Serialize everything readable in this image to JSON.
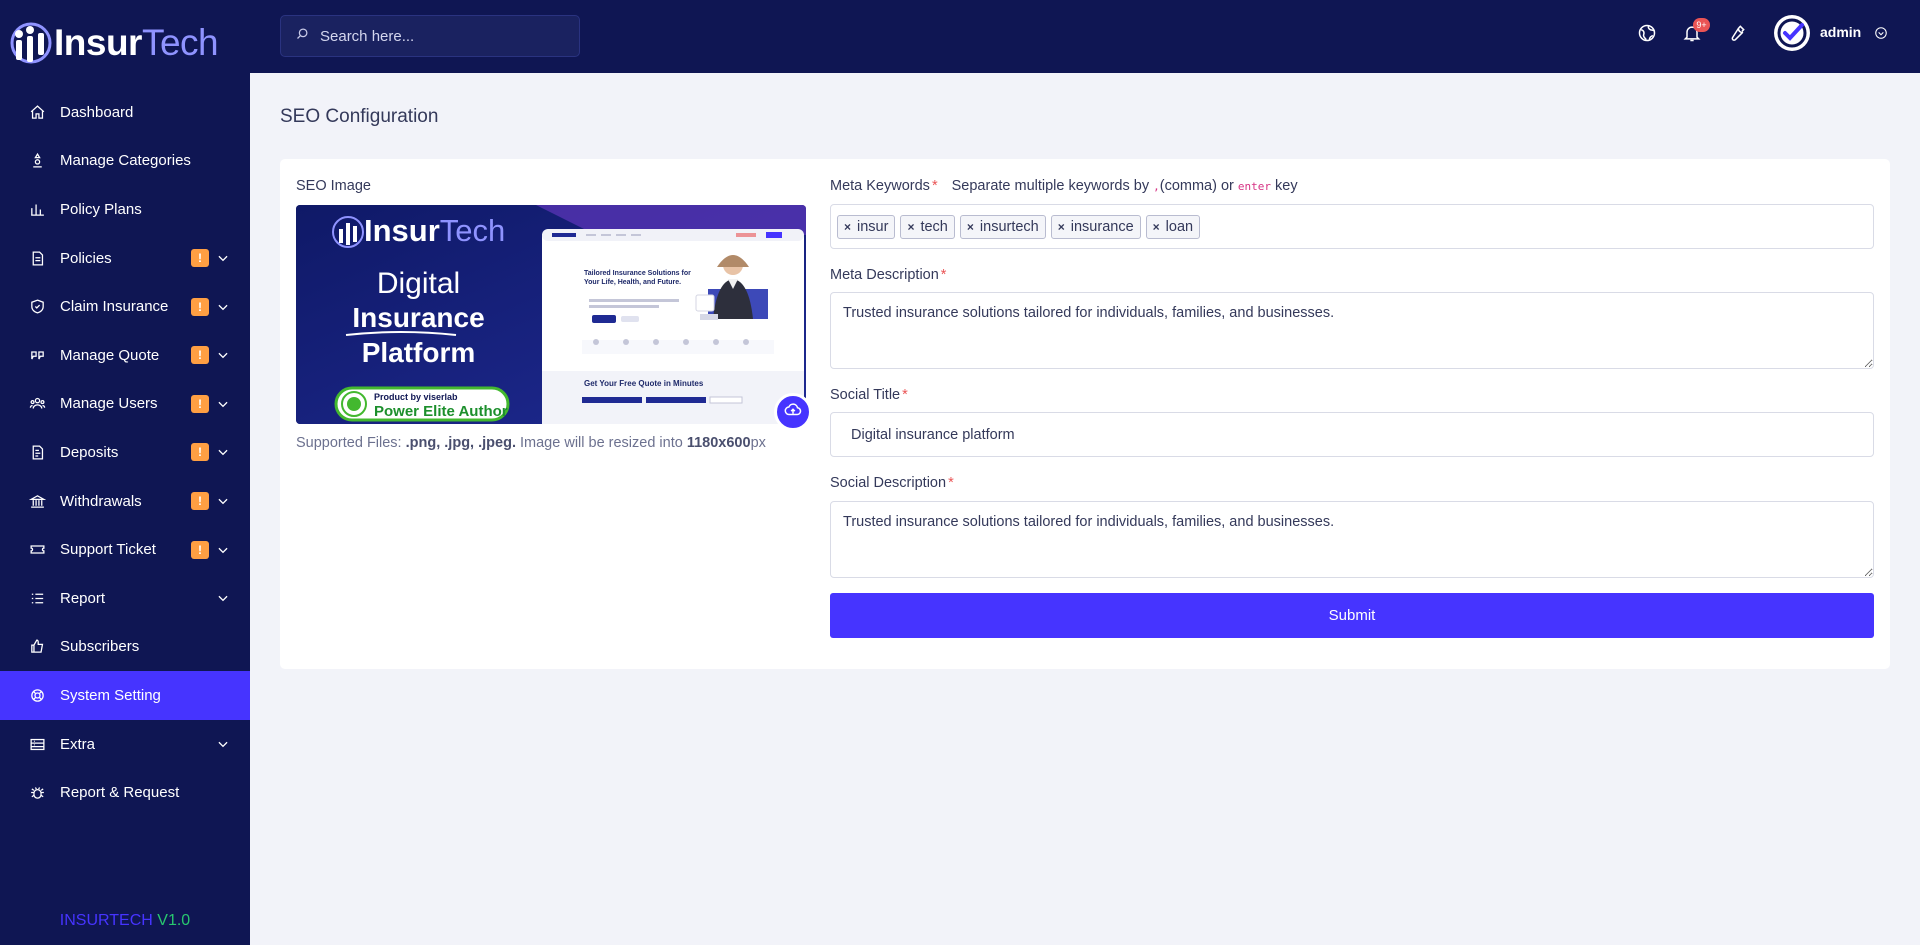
{
  "brand": {
    "name_part1": "Insur",
    "name_part2": "Tech"
  },
  "version": {
    "name": "INSURTECH",
    "number": "V1.0"
  },
  "search": {
    "placeholder": "Search here..."
  },
  "notifications": {
    "count": "9+"
  },
  "user": {
    "name": "admin"
  },
  "sidebar": {
    "items": [
      {
        "label": "Dashboard",
        "icon": "home-icon"
      },
      {
        "label": "Manage Categories",
        "icon": "category-icon"
      },
      {
        "label": "Policy Plans",
        "icon": "chart-icon"
      },
      {
        "label": "Policies",
        "icon": "document-icon",
        "badge": "!"
      },
      {
        "label": "Claim Insurance",
        "icon": "shield-icon",
        "badge": "!"
      },
      {
        "label": "Manage Quote",
        "icon": "quote-icon",
        "badge": "!"
      },
      {
        "label": "Manage Users",
        "icon": "users-icon",
        "badge": "!"
      },
      {
        "label": "Deposits",
        "icon": "deposit-icon",
        "badge": "!"
      },
      {
        "label": "Withdrawals",
        "icon": "bank-icon",
        "badge": "!"
      },
      {
        "label": "Support Ticket",
        "icon": "ticket-icon",
        "badge": "!"
      },
      {
        "label": "Report",
        "icon": "list-icon"
      },
      {
        "label": "Subscribers",
        "icon": "thumbs-up-icon"
      },
      {
        "label": "System Setting",
        "icon": "life-ring-icon",
        "active": true
      },
      {
        "label": "Extra",
        "icon": "server-icon"
      },
      {
        "label": "Report & Request",
        "icon": "bug-icon"
      }
    ]
  },
  "page": {
    "title": "SEO Configuration"
  },
  "form": {
    "seo_image_label": "SEO Image",
    "supported_prefix": "Supported Files: ",
    "supported_types": ".png, .jpg, .jpeg.",
    "supported_mid": " Image will be resized into ",
    "supported_size": "1180x600",
    "supported_unit": "px",
    "meta_keywords_label": "Meta Keywords",
    "keywords_hint_1": "Separate multiple keywords by ",
    "keywords_hint_comma": ",",
    "keywords_hint_2": "(comma) or ",
    "keywords_hint_enter": "enter",
    "keywords_hint_3": " key",
    "keywords": [
      "insur",
      "tech",
      "insurtech",
      "insurance",
      "loan"
    ],
    "meta_description_label": "Meta Description",
    "meta_description": "Trusted insurance solutions tailored for individuals, families, and businesses.",
    "social_title_label": "Social Title",
    "social_title": "Digital insurance platform",
    "social_description_label": "Social Description",
    "social_description": "Trusted insurance solutions tailored for individuals, families, and businesses.",
    "submit_label": "Submit"
  },
  "banner": {
    "logo_part1": "Insur",
    "logo_part2": "Tech",
    "line1": "Digital",
    "line2": "Insurance",
    "line3": "Platform",
    "badge_top": "Product by viserlab",
    "badge_bottom": "Power Elite Author",
    "preview_headline": "Tailored Insurance Solutions for Your Life, Health, and Future.",
    "preview_quote": "Get Your Free Quote in Minutes"
  },
  "colors": {
    "sidebar": "#0f1653",
    "accent": "#4634ff",
    "badge": "#ff9f43",
    "required": "#ea5455"
  }
}
